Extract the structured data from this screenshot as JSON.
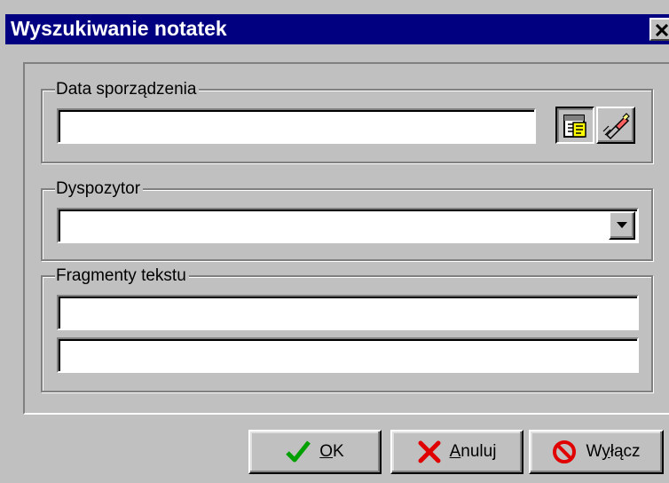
{
  "window": {
    "title": "Wyszukiwanie notatek",
    "close_glyph": "✕"
  },
  "date_group": {
    "legend": "Data sporządzenia",
    "value": "",
    "calendar_icon": "calendar-picker-icon",
    "clear_icon": "eraser-icon"
  },
  "dispatcher_group": {
    "legend": "Dyspozytor",
    "selected": ""
  },
  "text_group": {
    "legend": "Fragmenty tekstu",
    "fragment1": "",
    "fragment2": ""
  },
  "buttons": {
    "ok": {
      "accel": "O",
      "rest": "K",
      "icon": "checkmark-icon",
      "icon_color": "#00a000"
    },
    "cancel": {
      "accel": "A",
      "rest": "nuluj",
      "icon": "x-icon",
      "icon_color": "#e00000"
    },
    "off": {
      "pre": "W",
      "accel": "y",
      "rest": "łącz",
      "icon": "no-entry-icon",
      "icon_color": "#e00000"
    }
  },
  "colors": {
    "titlebar": "#000080",
    "face": "#c0c0c0"
  }
}
